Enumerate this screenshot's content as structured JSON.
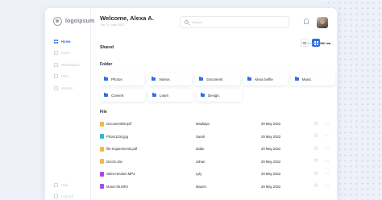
{
  "brand": {
    "logo_text": "logoipsum"
  },
  "sidebar": {
    "items": [
      {
        "label": "Home",
        "active": true
      },
      {
        "label": "Event",
        "active": false
      },
      {
        "label": "Marketplace",
        "active": false
      },
      {
        "label": "Files",
        "active": false
      },
      {
        "label": "Interest",
        "active": false
      }
    ],
    "bottom_items": [
      {
        "label": "Help"
      },
      {
        "label": "Log Out"
      }
    ]
  },
  "header": {
    "greeting": "Welcome, Alexa A.",
    "date": "Tue, 07 June 2022",
    "search_placeholder": "Search"
  },
  "shared": {
    "title": "Shared",
    "filter_label": "Files stored:",
    "filter_value": "300 mb"
  },
  "folder_section": {
    "title": "Folder",
    "rows": [
      [
        {
          "name": "Photos"
        },
        {
          "name": "Videos"
        },
        {
          "name": "Document"
        },
        {
          "name": "Alexa Selfie"
        },
        {
          "name": "Music"
        }
      ],
      [
        {
          "name": "Convert"
        },
        {
          "name": "Learn"
        },
        {
          "name": "Design."
        }
      ]
    ]
  },
  "file_section": {
    "title": "File",
    "rows": [
      {
        "name": "Document09.pdf",
        "owner": "Maulidya",
        "date": "29 May 2022",
        "icon_color": "#f4b942"
      },
      {
        "name": "Photo1234.jpg",
        "owner": "Sarah",
        "date": "29 May 2022",
        "icon_color": "#2fb7c9"
      },
      {
        "name": "file-requirements.pdf",
        "owner": "Zidan",
        "date": "29 May 2022",
        "icon_color": "#f4b942"
      },
      {
        "name": "Doc01.doc",
        "owner": "Johan",
        "date": "29 May 2022",
        "icon_color": "#f4b942"
      },
      {
        "name": "video-random.MP4",
        "owner": "Lyly",
        "date": "29 May 2022",
        "icon_color": "#a64ce6"
      },
      {
        "name": "Music-05.MP3",
        "owner": "Maurin",
        "date": "29 May 2022",
        "icon_color": "#a64ce6"
      }
    ]
  },
  "colors": {
    "accent": "#2f6fe6",
    "background": "#eef1f8"
  }
}
